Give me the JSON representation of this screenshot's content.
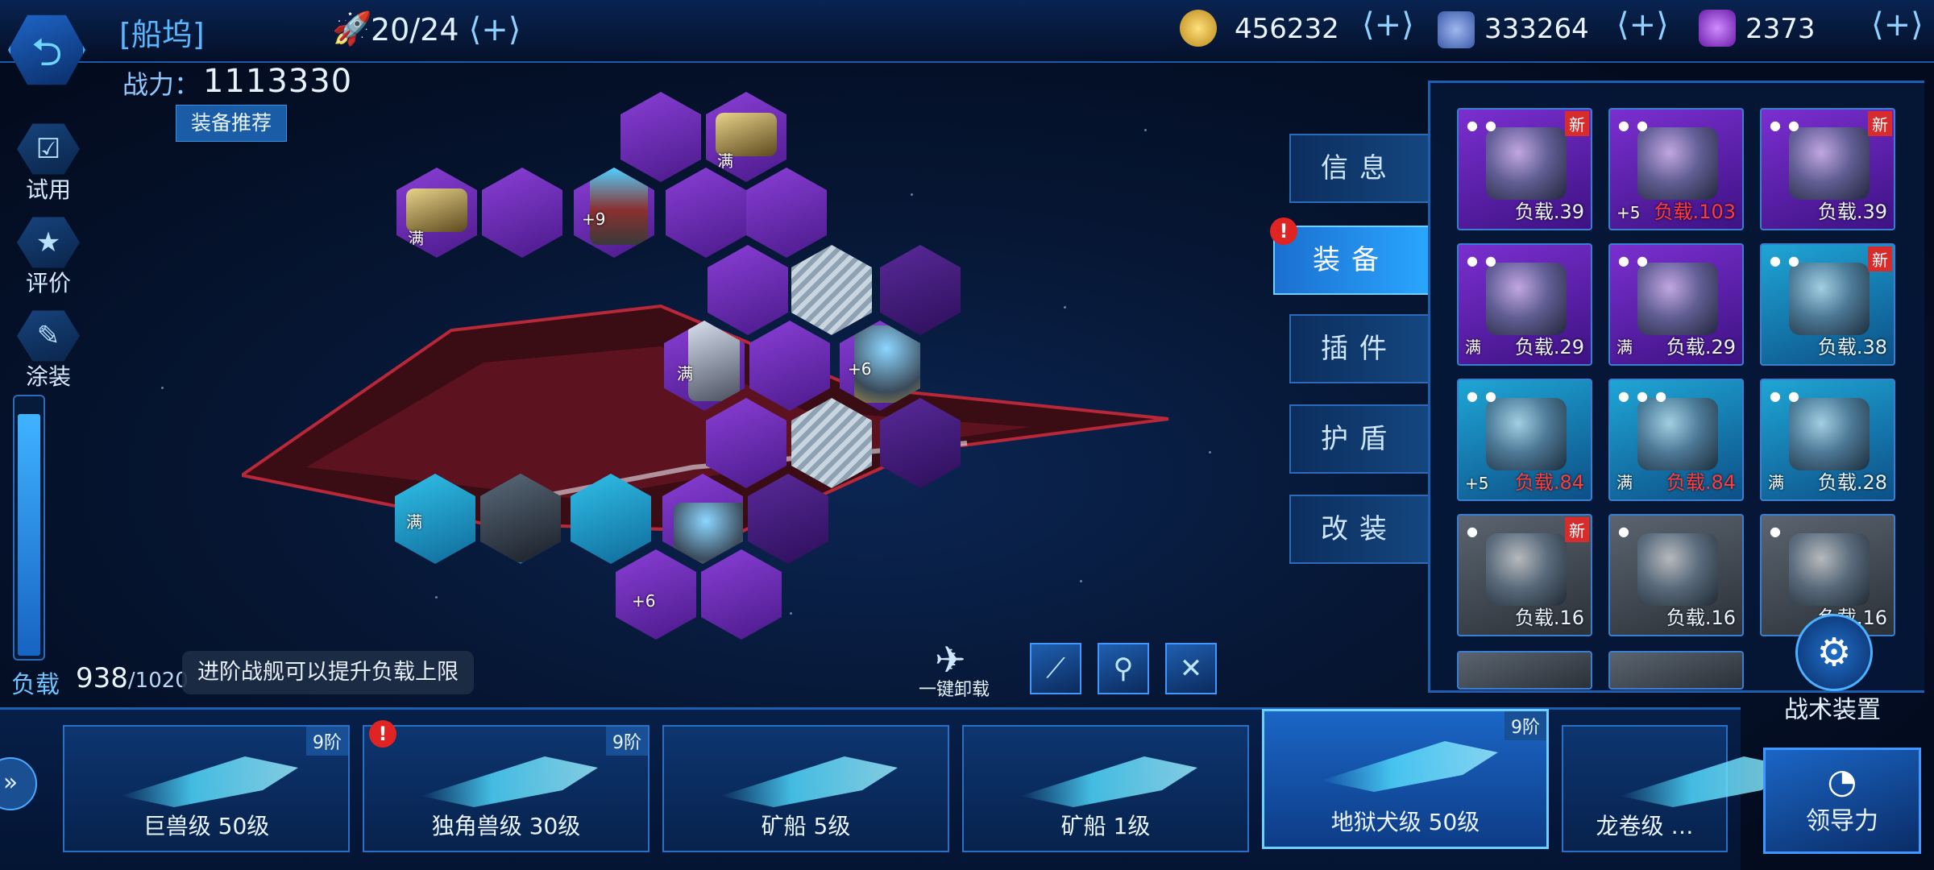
{
  "header": {
    "title": "[船坞]",
    "fleet_count": "20/24",
    "plus": "⟨+⟩",
    "resources": [
      {
        "name": "gold-coin",
        "value": "456232",
        "color": "#d8b13a"
      },
      {
        "name": "crystal-ore",
        "value": "333264",
        "color": "#6f8fd8"
      },
      {
        "name": "purple-gem",
        "value": "2373",
        "color": "#a24de0"
      }
    ]
  },
  "power": {
    "label": "战力：",
    "value": "1113330"
  },
  "recommend_label": "装备推荐",
  "side_menu": [
    {
      "label": "试用",
      "icon": "checkbox-icon"
    },
    {
      "label": "评价",
      "icon": "rating-card-icon"
    },
    {
      "label": "涂装",
      "icon": "spray-can-icon"
    }
  ],
  "load": {
    "label": "负载",
    "value": "938",
    "max": "/1020",
    "fraction": 0.92
  },
  "tip": "进阶战舰可以提升负载上限",
  "hex_tags": {
    "full": "满",
    "plus9": "+9",
    "plus6": "+6"
  },
  "tabs": [
    "信息",
    "装备",
    "插件",
    "护盾",
    "改装"
  ],
  "active_tab": "装备",
  "alert": "!",
  "inventory": [
    {
      "stars": "● ●",
      "new": "新",
      "load": "负载.39",
      "red": false,
      "tag": "",
      "rarity": "purple"
    },
    {
      "stars": "● ●",
      "new": "",
      "load": "负载.103",
      "red": true,
      "tag": "+5",
      "rarity": "purple"
    },
    {
      "stars": "● ●",
      "new": "新",
      "load": "负载.39",
      "red": false,
      "tag": "",
      "rarity": "purple"
    },
    {
      "stars": "● ●",
      "new": "",
      "load": "负载.29",
      "red": false,
      "tag": "满",
      "rarity": "purple"
    },
    {
      "stars": "● ●",
      "new": "",
      "load": "负载.29",
      "red": false,
      "tag": "满",
      "rarity": "purple"
    },
    {
      "stars": "● ●",
      "new": "新",
      "load": "负载.38",
      "red": false,
      "tag": "",
      "rarity": "cyan"
    },
    {
      "stars": "● ●",
      "new": "",
      "load": "负载.84",
      "red": true,
      "tag": "+5",
      "rarity": "cyan"
    },
    {
      "stars": "● ● ●",
      "new": "",
      "load": "负载.84",
      "red": true,
      "tag": "满",
      "rarity": "cyan"
    },
    {
      "stars": "● ●",
      "new": "",
      "load": "负载.28",
      "red": false,
      "tag": "满",
      "rarity": "cyan"
    },
    {
      "stars": "●",
      "new": "新",
      "load": "负载.16",
      "red": false,
      "tag": "",
      "rarity": "grey"
    },
    {
      "stars": "●",
      "new": "",
      "load": "负载.16",
      "red": false,
      "tag": "",
      "rarity": "grey"
    },
    {
      "stars": "●",
      "new": "",
      "load": "负载.16",
      "red": false,
      "tag": "",
      "rarity": "grey"
    }
  ],
  "tactics_label": "战术装置",
  "unload_label": "一键卸载",
  "filters": [
    "missile-filter-icon",
    "turret-filter-icon",
    "drone-filter-icon"
  ],
  "ships": [
    {
      "name": "巨兽级 50级",
      "rank": "9阶",
      "alert": false
    },
    {
      "name": "独角兽级 30级",
      "rank": "9阶",
      "alert": true
    },
    {
      "name": "矿船 5级",
      "rank": "",
      "alert": false
    },
    {
      "name": "矿船 1级",
      "rank": "",
      "alert": false
    },
    {
      "name": "地狱犬级 50级",
      "rank": "9阶",
      "alert": false,
      "active": true
    },
    {
      "name": "龙卷级 …",
      "rank": "",
      "alert": false
    }
  ],
  "leader_label": "领导力"
}
